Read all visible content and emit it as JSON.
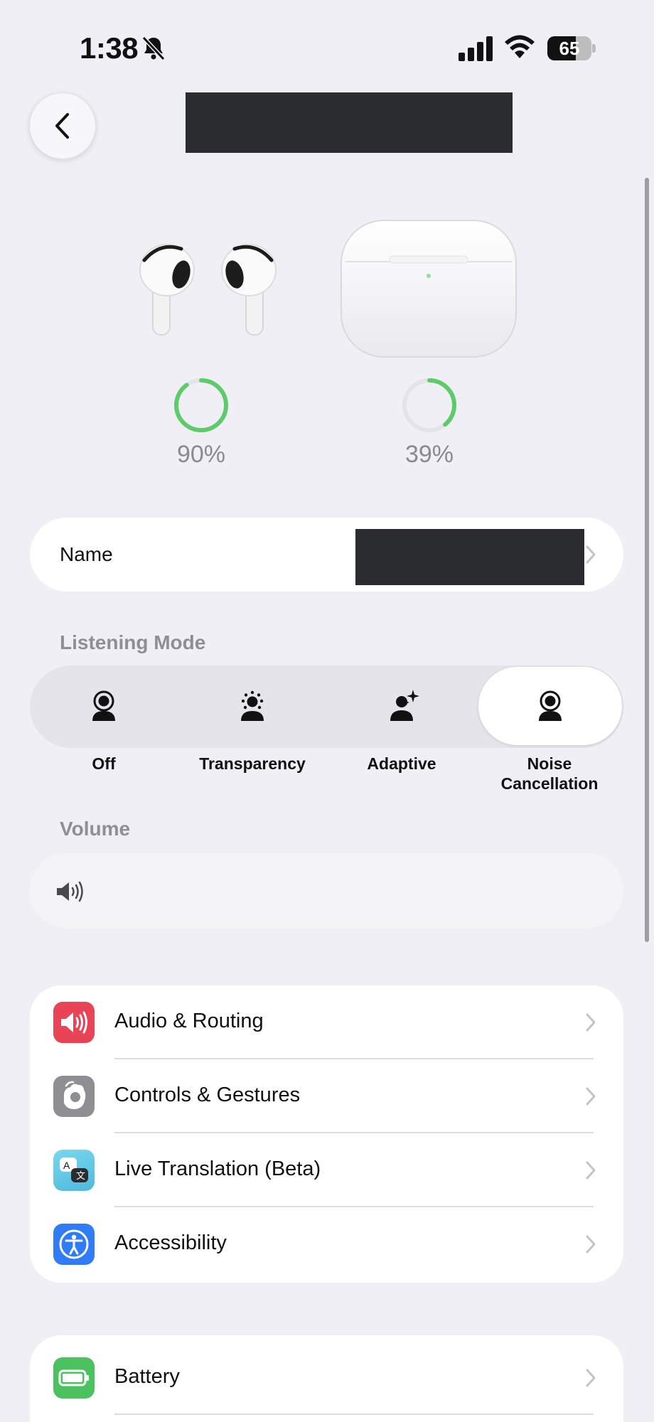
{
  "status_bar": {
    "time": "1:38",
    "battery_level": "65",
    "icons": [
      "mute-bell-icon",
      "cellular-signal-icon",
      "wifi-icon",
      "battery-icon"
    ]
  },
  "nav": {
    "back_icon": "chevron-left-icon"
  },
  "devices": {
    "earbuds": {
      "battery_percent": 90,
      "battery_label": "90%",
      "ring_color": "#5ecb6a"
    },
    "case": {
      "battery_percent": 39,
      "battery_label": "39%",
      "ring_color": "#5ecb6a"
    }
  },
  "name_row": {
    "label": "Name"
  },
  "listening_mode": {
    "header": "Listening Mode",
    "options": [
      {
        "label": "Off",
        "icon": "listening-off-icon",
        "selected": false
      },
      {
        "label": "Transparency",
        "icon": "transparency-icon",
        "selected": false
      },
      {
        "label": "Adaptive",
        "icon": "adaptive-icon",
        "selected": false
      },
      {
        "label_line1": "Noise",
        "label_line2": "Cancellation",
        "icon": "noise-cancellation-icon",
        "selected": true
      }
    ]
  },
  "volume": {
    "header": "Volume",
    "icon": "speaker-icon"
  },
  "settings_group_1": [
    {
      "label": "Audio & Routing",
      "icon": "speaker-icon",
      "icon_color": "#e94356"
    },
    {
      "label": "Controls & Gestures",
      "icon": "gesture-hand-icon",
      "icon_color": "#8e8e93"
    },
    {
      "label": "Live Translation (Beta)",
      "icon": "translate-icon",
      "icon_color": "#5ac8e0"
    },
    {
      "label": "Accessibility",
      "icon": "accessibility-icon",
      "icon_color": "#2f7cf6"
    }
  ],
  "settings_group_2": [
    {
      "label": "Battery",
      "icon": "battery-icon",
      "icon_color": "#4cc25e"
    }
  ],
  "colors": {
    "background": "#f0eff5",
    "ring_track": "#e3e3e8",
    "ring_fill": "#5ecb6a"
  }
}
